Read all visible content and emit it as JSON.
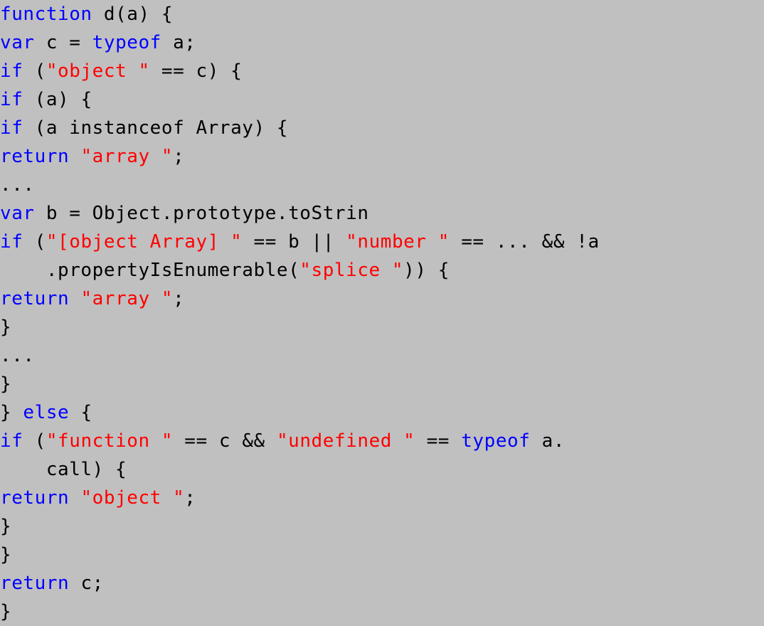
{
  "listing": {
    "kind": "source-code-listing",
    "language": "JavaScript",
    "background_color": "#c0c0c0",
    "keyword_color": "#0000ff",
    "string_color": "#ff0000",
    "text_color": "#000000",
    "line_count": 22,
    "plain_text": "function d(a) {\nvar c = typeof a;\nif (\"object \" == c) {\nif (a) {\nif (a instanceof Array) {\nreturn \"array \";\n...\nvar b = Object.prototype.toStrin\nif (\"[object Array] \" == b || \"number \" == ... && !a\n    .propertyIsEnumerable(\"splice \")) {\nreturn \"array \";\n}\n...\n}\n} else {\nif (\"function \" == c && \"undefined \" == typeof a.\n    call) {\nreturn \"object \";\n}\n}\nreturn c;\n}",
    "lines": [
      {
        "id": "line-1",
        "tokens": [
          {
            "t": "function",
            "c": "kw"
          },
          {
            "t": " d(a) {",
            "c": "txt"
          }
        ]
      },
      {
        "id": "line-2",
        "tokens": [
          {
            "t": "var",
            "c": "kw"
          },
          {
            "t": " c = ",
            "c": "txt"
          },
          {
            "t": "typeof",
            "c": "kw"
          },
          {
            "t": " a;",
            "c": "txt"
          }
        ]
      },
      {
        "id": "line-3",
        "tokens": [
          {
            "t": "if",
            "c": "kw"
          },
          {
            "t": " (",
            "c": "txt"
          },
          {
            "t": "\"object \"",
            "c": "str"
          },
          {
            "t": " == c) {",
            "c": "txt"
          }
        ]
      },
      {
        "id": "line-4",
        "tokens": [
          {
            "t": "if",
            "c": "kw"
          },
          {
            "t": " (a) {",
            "c": "txt"
          }
        ]
      },
      {
        "id": "line-5",
        "tokens": [
          {
            "t": "if",
            "c": "kw"
          },
          {
            "t": " (a instanceof Array) {",
            "c": "txt"
          }
        ]
      },
      {
        "id": "line-6",
        "tokens": [
          {
            "t": "return",
            "c": "kw"
          },
          {
            "t": " ",
            "c": "txt"
          },
          {
            "t": "\"array \"",
            "c": "str"
          },
          {
            "t": ";",
            "c": "txt"
          }
        ]
      },
      {
        "id": "line-7",
        "tokens": [
          {
            "t": "...",
            "c": "ell"
          }
        ]
      },
      {
        "id": "line-8",
        "tokens": [
          {
            "t": "var",
            "c": "kw"
          },
          {
            "t": " b = Object.prototype.toStrin",
            "c": "txt"
          }
        ]
      },
      {
        "id": "line-9",
        "tokens": [
          {
            "t": "if",
            "c": "kw"
          },
          {
            "t": " (",
            "c": "txt"
          },
          {
            "t": "\"[object Array] \"",
            "c": "str"
          },
          {
            "t": " == b || ",
            "c": "txt"
          },
          {
            "t": "\"number \"",
            "c": "str"
          },
          {
            "t": " == ... && !a",
            "c": "txt"
          }
        ]
      },
      {
        "id": "line-10",
        "tokens": [
          {
            "t": "    .propertyIsEnumerable(",
            "c": "txt"
          },
          {
            "t": "\"splice \"",
            "c": "str"
          },
          {
            "t": ")) {",
            "c": "txt"
          }
        ]
      },
      {
        "id": "line-11",
        "tokens": [
          {
            "t": "return",
            "c": "kw"
          },
          {
            "t": " ",
            "c": "txt"
          },
          {
            "t": "\"array \"",
            "c": "str"
          },
          {
            "t": ";",
            "c": "txt"
          }
        ]
      },
      {
        "id": "line-12",
        "tokens": [
          {
            "t": "}",
            "c": "txt"
          }
        ]
      },
      {
        "id": "line-13",
        "tokens": [
          {
            "t": "...",
            "c": "ell"
          }
        ]
      },
      {
        "id": "line-14",
        "tokens": [
          {
            "t": "}",
            "c": "txt"
          }
        ]
      },
      {
        "id": "line-15",
        "tokens": [
          {
            "t": "} ",
            "c": "txt"
          },
          {
            "t": "else",
            "c": "kw"
          },
          {
            "t": " {",
            "c": "txt"
          }
        ]
      },
      {
        "id": "line-16",
        "tokens": [
          {
            "t": "if",
            "c": "kw"
          },
          {
            "t": " (",
            "c": "txt"
          },
          {
            "t": "\"function \"",
            "c": "str"
          },
          {
            "t": " == c && ",
            "c": "txt"
          },
          {
            "t": "\"undefined \"",
            "c": "str"
          },
          {
            "t": " == ",
            "c": "txt"
          },
          {
            "t": "typeof",
            "c": "kw"
          },
          {
            "t": " a.",
            "c": "txt"
          }
        ]
      },
      {
        "id": "line-17",
        "tokens": [
          {
            "t": "    call) {",
            "c": "txt"
          }
        ]
      },
      {
        "id": "line-18",
        "tokens": [
          {
            "t": "return",
            "c": "kw"
          },
          {
            "t": " ",
            "c": "txt"
          },
          {
            "t": "\"object \"",
            "c": "str"
          },
          {
            "t": ";",
            "c": "txt"
          }
        ]
      },
      {
        "id": "line-19",
        "tokens": [
          {
            "t": "}",
            "c": "txt"
          }
        ]
      },
      {
        "id": "line-20",
        "tokens": [
          {
            "t": "}",
            "c": "txt"
          }
        ]
      },
      {
        "id": "line-21",
        "tokens": [
          {
            "t": "return",
            "c": "kw"
          },
          {
            "t": " c;",
            "c": "txt"
          }
        ]
      },
      {
        "id": "line-22",
        "tokens": [
          {
            "t": "}",
            "c": "txt"
          }
        ]
      }
    ]
  }
}
